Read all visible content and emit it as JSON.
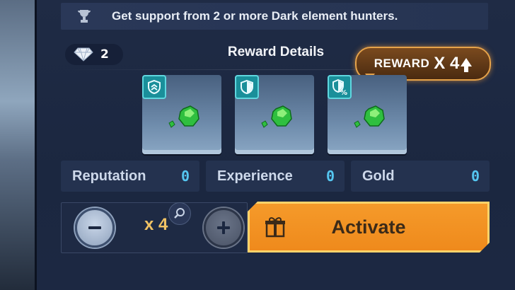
{
  "banner": {
    "text": "Get support from 2 or more Dark element hunters.",
    "icon": "trophy-icon"
  },
  "gem_chip": {
    "icon": "diamond-icon",
    "count": "2"
  },
  "reward": {
    "title": "Reward Details",
    "badge_label": "REWARD",
    "badge_multiplier": "X 4",
    "badge_icon": "up-arrow-icon"
  },
  "cards": [
    {
      "icon": "chevron-shield-icon",
      "item": "green-gem-icon"
    },
    {
      "icon": "shield-icon",
      "item": "green-gem-icon"
    },
    {
      "icon": "shield-percent-icon",
      "item": "green-gem-icon"
    }
  ],
  "stats": [
    {
      "name": "Reputation",
      "value": "0"
    },
    {
      "name": "Experience",
      "value": "0"
    },
    {
      "name": "Gold",
      "value": "0"
    }
  ],
  "quantity": {
    "value": "x 4",
    "minus_icon": "minus-icon",
    "plus_icon": "plus-icon",
    "zoom_icon": "magnifier-icon"
  },
  "activate": {
    "label": "Activate",
    "icon": "gift-icon"
  },
  "colors": {
    "accent_orange": "#ef8a1c",
    "stat_value": "#55c6f0",
    "gem_green": "#2fbf3f",
    "quantity_gold": "#f0c264"
  }
}
